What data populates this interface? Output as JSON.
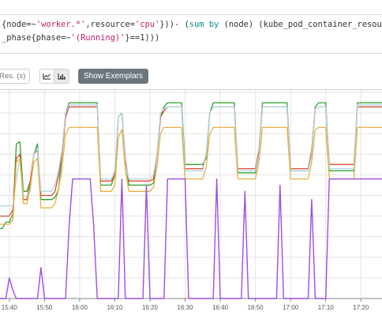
{
  "query": {
    "line1": [
      {
        "t": "{",
        "c": "plain"
      },
      {
        "t": "node",
        "c": "plain"
      },
      {
        "t": "=~",
        "c": "plain"
      },
      {
        "t": "'worker.*'",
        "c": "str"
      },
      {
        "t": ",",
        "c": "plain"
      },
      {
        "t": "resource",
        "c": "plain"
      },
      {
        "t": "=",
        "c": "plain"
      },
      {
        "t": "'cpu'",
        "c": "str"
      },
      {
        "t": "}))- (",
        "c": "plain"
      },
      {
        "t": "sum",
        "c": "kw"
      },
      {
        "t": " ",
        "c": "plain"
      },
      {
        "t": "by",
        "c": "kw"
      },
      {
        "t": " (node) (kube_pod_container_resource_requests{node=",
        "c": "plain"
      }
    ],
    "line2": [
      {
        "t": "_phase{phase=~",
        "c": "plain"
      },
      {
        "t": "'(Running)'",
        "c": "str"
      },
      {
        "t": "}==1)))",
        "c": "plain"
      }
    ]
  },
  "toolbar": {
    "resolution_placeholder": "Res. (s)",
    "stacked_icon": "line-chart-icon",
    "bar_icon": "area-chart-icon",
    "exemplars_label": "Show Exemplars"
  },
  "chart_data": {
    "type": "line",
    "x_tick_labels": [
      "15:40",
      "15:50",
      "16:00",
      "16:10",
      "16:20",
      "16:30",
      "16:40",
      "16:50",
      "17:00",
      "17:10",
      "17:20"
    ],
    "x": [
      "15:36",
      "15:37",
      "15:38",
      "15:39",
      "15:40",
      "15:41",
      "15:42",
      "15:43",
      "15:44",
      "15:45",
      "15:46",
      "15:47",
      "15:48",
      "15:49",
      "15:50",
      "15:51",
      "15:52",
      "15:53",
      "15:54",
      "15:55",
      "15:56",
      "15:57",
      "15:58",
      "15:59",
      "16:00",
      "16:01",
      "16:02",
      "16:03",
      "16:04",
      "16:05",
      "16:06",
      "16:07",
      "16:08",
      "16:09",
      "16:10",
      "16:11",
      "16:12",
      "16:13",
      "16:14",
      "16:15",
      "16:16",
      "16:17",
      "16:18",
      "16:19",
      "16:20",
      "16:21",
      "16:22",
      "16:23",
      "16:24",
      "16:25",
      "16:26",
      "16:27",
      "16:28",
      "16:29",
      "16:30",
      "16:31",
      "16:32",
      "16:33",
      "16:34",
      "16:35",
      "16:36",
      "16:37",
      "16:38",
      "16:39",
      "16:40",
      "16:41",
      "16:42",
      "16:43",
      "16:44",
      "16:45",
      "16:46",
      "16:47",
      "16:48",
      "16:49",
      "16:50",
      "16:51",
      "16:52",
      "16:53",
      "16:54",
      "16:55",
      "16:56",
      "16:57",
      "16:58",
      "16:59",
      "17:00",
      "17:01",
      "17:02",
      "17:03",
      "17:04",
      "17:05",
      "17:06",
      "17:07",
      "17:08",
      "17:09",
      "17:10",
      "17:11",
      "17:12",
      "17:13",
      "17:14",
      "17:15",
      "17:16",
      "17:17",
      "17:18",
      "17:19",
      "17:20",
      "17:21",
      "17:22",
      "17:23",
      "17:24",
      "17:25",
      "17:26"
    ],
    "ylim": [
      0,
      100
    ],
    "grid": true,
    "series": [
      {
        "color": "#2ca02c",
        "values": [
          34,
          34,
          34,
          37,
          37,
          41,
          75,
          76,
          52,
          52,
          57,
          70,
          75,
          48,
          48,
          48,
          48,
          49,
          53,
          70,
          90,
          95,
          95,
          95,
          95,
          95,
          95,
          95,
          95,
          95,
          55,
          55,
          55,
          55,
          60,
          88,
          90,
          67,
          55,
          55,
          55,
          55,
          55,
          55,
          55,
          56,
          70,
          88,
          93,
          95,
          95,
          95,
          95,
          95,
          65,
          65,
          65,
          65,
          65,
          65,
          68,
          90,
          95,
          95,
          95,
          95,
          95,
          95,
          95,
          61,
          61,
          61,
          61,
          61,
          61,
          70,
          95,
          95,
          95,
          95,
          95,
          95,
          95,
          95,
          62,
          62,
          62,
          62,
          62,
          62,
          70,
          93,
          95,
          95,
          95,
          62,
          62,
          62,
          62,
          62,
          62,
          62,
          62,
          95,
          95,
          95,
          95,
          95,
          95,
          95,
          95
        ]
      },
      {
        "color": "#d94c34",
        "values": [
          40,
          40,
          40,
          40,
          40,
          43,
          68,
          70,
          48,
          48,
          57,
          70,
          72,
          50,
          50,
          50,
          50,
          52,
          60,
          70,
          88,
          93,
          93,
          93,
          93,
          93,
          93,
          93,
          93,
          93,
          57,
          57,
          57,
          57,
          60,
          88,
          90,
          67,
          57,
          57,
          57,
          57,
          57,
          57,
          57,
          58,
          70,
          88,
          91,
          93,
          93,
          93,
          93,
          93,
          63,
          63,
          63,
          63,
          63,
          63,
          70,
          90,
          93,
          93,
          93,
          93,
          93,
          93,
          93,
          63,
          63,
          63,
          63,
          63,
          63,
          72,
          93,
          93,
          93,
          93,
          93,
          93,
          93,
          93,
          63,
          63,
          63,
          63,
          63,
          63,
          72,
          92,
          93,
          93,
          93,
          65,
          65,
          65,
          65,
          65,
          65,
          65,
          65,
          93,
          93,
          93,
          93,
          93,
          93,
          93,
          93
        ]
      },
      {
        "color": "#aed6e6",
        "values": [
          45,
          45,
          45,
          45,
          45,
          45,
          58,
          68,
          50,
          50,
          52,
          70,
          73,
          52,
          52,
          52,
          52,
          55,
          62,
          72,
          90,
          94,
          94,
          94,
          94,
          94,
          94,
          94,
          94,
          94,
          58,
          58,
          58,
          58,
          62,
          88,
          90,
          65,
          58,
          58,
          58,
          58,
          58,
          58,
          58,
          60,
          70,
          90,
          92,
          93,
          93,
          93,
          93,
          93,
          62,
          62,
          62,
          62,
          62,
          62,
          70,
          90,
          93,
          93,
          93,
          93,
          93,
          93,
          93,
          62,
          62,
          62,
          62,
          62,
          62,
          70,
          93,
          93,
          93,
          93,
          93,
          93,
          93,
          93,
          62,
          62,
          62,
          62,
          62,
          62,
          70,
          92,
          93,
          93,
          93,
          63,
          63,
          63,
          63,
          63,
          63,
          63,
          63,
          94,
          94,
          94,
          94,
          94,
          94,
          94,
          94
        ]
      },
      {
        "color": "#e8b13f",
        "values": [
          36,
          36,
          36,
          36,
          36,
          38,
          66,
          68,
          46,
          46,
          55,
          66,
          68,
          44,
          44,
          44,
          44,
          46,
          53,
          63,
          80,
          83,
          83,
          83,
          83,
          83,
          83,
          83,
          83,
          83,
          52,
          52,
          52,
          52,
          55,
          78,
          82,
          62,
          52,
          52,
          52,
          52,
          52,
          52,
          52,
          54,
          64,
          80,
          83,
          83,
          83,
          83,
          83,
          83,
          58,
          58,
          58,
          58,
          58,
          58,
          64,
          80,
          83,
          83,
          83,
          83,
          83,
          83,
          83,
          58,
          58,
          58,
          58,
          58,
          58,
          66,
          83,
          83,
          83,
          83,
          83,
          83,
          83,
          83,
          58,
          58,
          58,
          58,
          58,
          58,
          66,
          82,
          83,
          83,
          83,
          58,
          58,
          58,
          58,
          58,
          58,
          58,
          58,
          83,
          83,
          83,
          83,
          83,
          83,
          83,
          83
        ]
      },
      {
        "color": "#9a4fe0",
        "values": [
          0,
          0,
          0,
          0,
          10,
          4,
          0,
          0,
          0,
          0,
          0,
          0,
          0,
          15,
          0,
          0,
          0,
          0,
          0,
          0,
          0,
          35,
          58,
          58,
          58,
          58,
          58,
          58,
          35,
          0,
          0,
          0,
          0,
          0,
          0,
          0,
          58,
          0,
          0,
          0,
          0,
          0,
          0,
          55,
          0,
          0,
          0,
          0,
          0,
          58,
          58,
          58,
          58,
          58,
          58,
          0,
          0,
          0,
          0,
          0,
          0,
          0,
          0,
          58,
          0,
          0,
          0,
          0,
          0,
          0,
          0,
          52,
          0,
          0,
          0,
          0,
          0,
          0,
          0,
          0,
          0,
          55,
          0,
          0,
          0,
          0,
          0,
          0,
          0,
          0,
          48,
          0,
          0,
          0,
          0,
          58,
          58,
          58,
          58,
          58,
          58,
          58,
          58,
          58,
          58,
          58,
          58,
          58,
          58,
          58,
          58
        ]
      }
    ]
  }
}
